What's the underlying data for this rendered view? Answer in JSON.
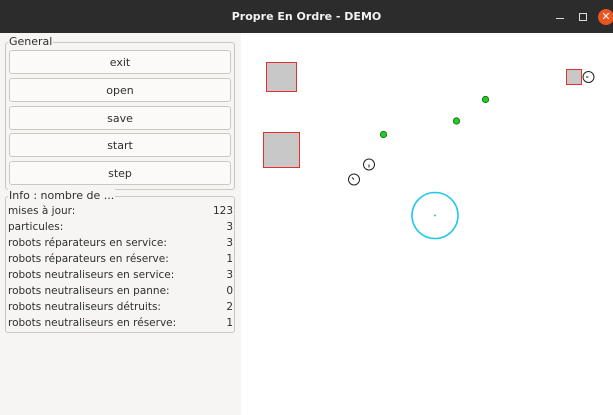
{
  "window": {
    "title": "Propre En Ordre - DEMO",
    "controls": [
      "minimize-icon",
      "maximize-icon",
      "close-icon"
    ],
    "close_glyph": "✕",
    "close_color": "#e95420"
  },
  "general": {
    "label": "General",
    "buttons": {
      "exit": "exit",
      "open": "open",
      "save": "save",
      "start": "start",
      "step": "step"
    }
  },
  "info": {
    "label": "Info : nombre de ...",
    "rows": [
      {
        "label": "mises à jour:",
        "value": "123"
      },
      {
        "label": "particules:",
        "value": "3"
      },
      {
        "label": "robots réparateurs en service:",
        "value": "3"
      },
      {
        "label": "robots réparateurs en réserve:",
        "value": "1"
      },
      {
        "label": "robots neutraliseurs en service:",
        "value": "3"
      },
      {
        "label": "robots neutraliseurs en panne:",
        "value": "0"
      },
      {
        "label": "robots neutraliseurs détruits:",
        "value": "2"
      },
      {
        "label": "robots neutraliseurs en réserve:",
        "value": "1"
      }
    ]
  },
  "colors": {
    "particle_fill": "#c8c8c8",
    "particle_border": "#e03030",
    "repair_robot": "#22cc22",
    "neutralizer_robot": "#222222",
    "spatial_robot": "#22c8e8"
  }
}
